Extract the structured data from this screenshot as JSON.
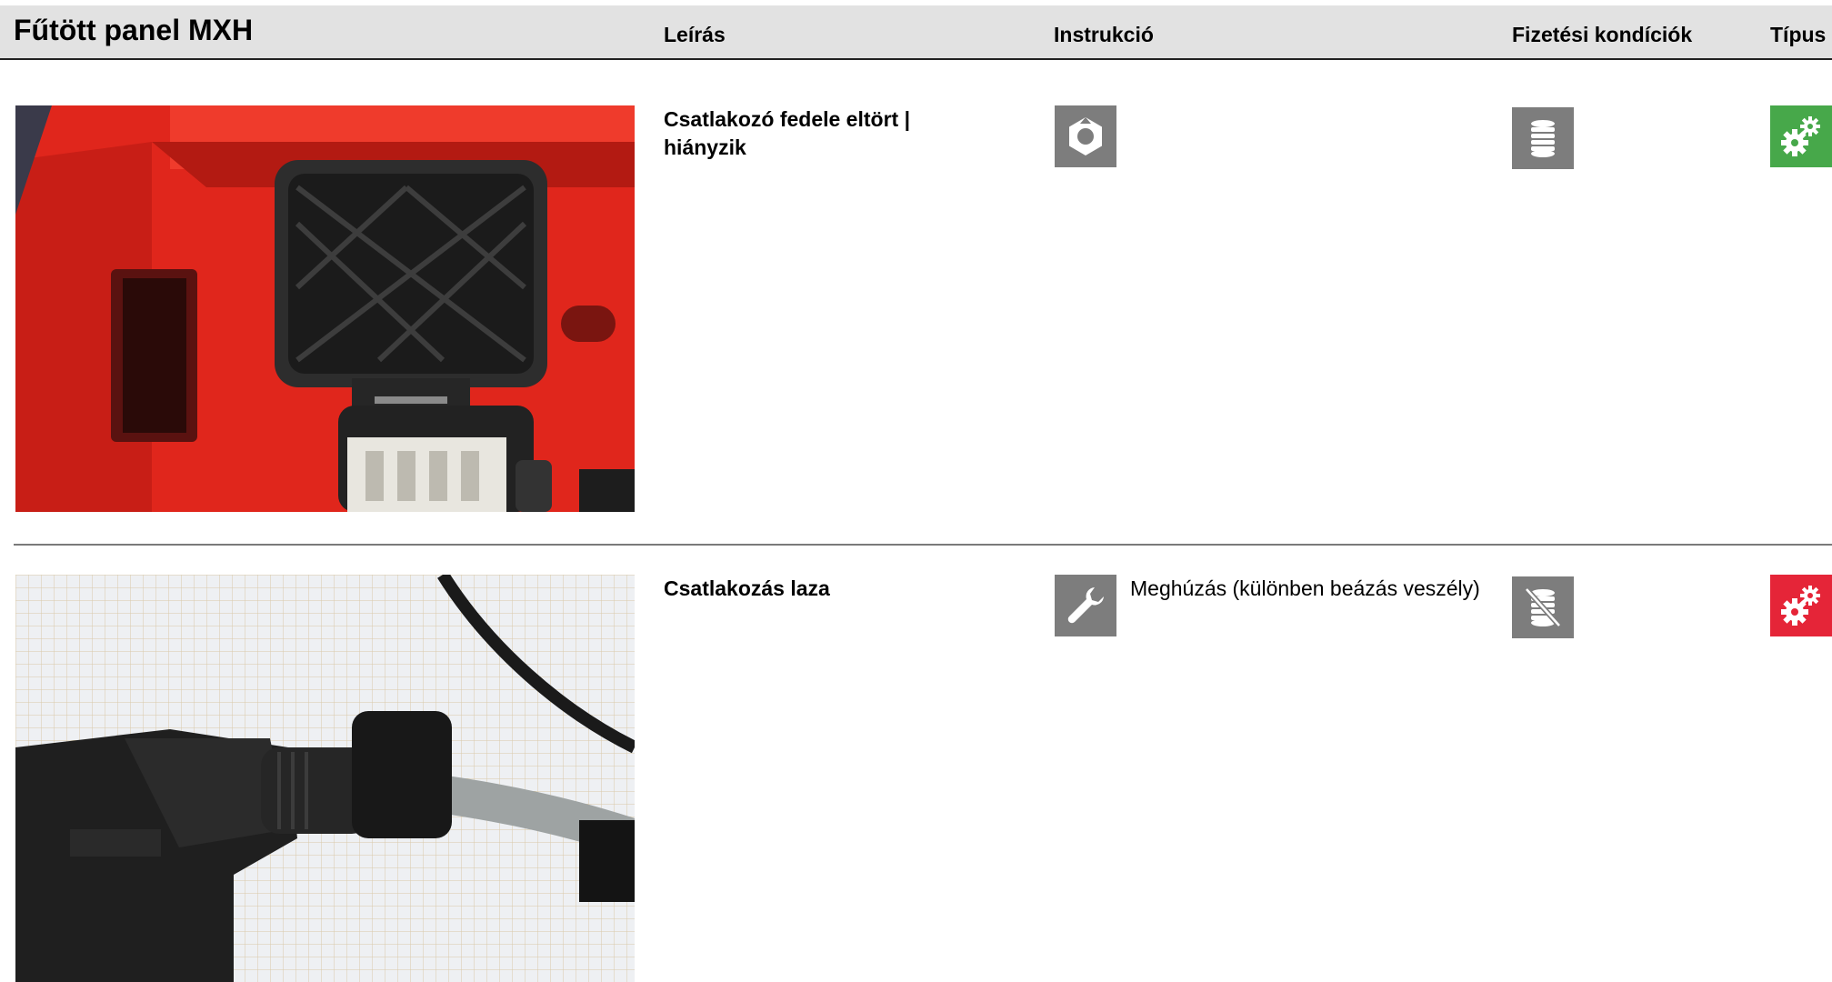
{
  "header": {
    "title": "Fűtött panel MXH",
    "col_description": "Leírás",
    "col_instruction": "Instrukció",
    "col_payment": "Fizetési kondíciók",
    "col_type": "Típus"
  },
  "rows": [
    {
      "description": "Csatlakozó fedele eltört | hiányzik",
      "instruction_icon": "nut-icon",
      "instruction_text": "",
      "payment_icon": "coin-stack-icon",
      "type_icon": "gears-icon",
      "type_color": "#47a84a",
      "photo": "red frame with open black connector cover"
    },
    {
      "description": "Csatlakozás laza",
      "instruction_icon": "wrench-icon",
      "instruction_text": "Meghúzás (különben beázás veszély)",
      "payment_icon": "coin-stack-crossed-icon",
      "type_icon": "gears-icon",
      "type_color": "#e52538",
      "photo": "black connector plug with grey cable on grid paper"
    }
  ],
  "colors": {
    "header_bg": "#e2e2e2",
    "icon_gray": "#7d7d7d",
    "type_green": "#47a84a",
    "type_red": "#e52538"
  }
}
